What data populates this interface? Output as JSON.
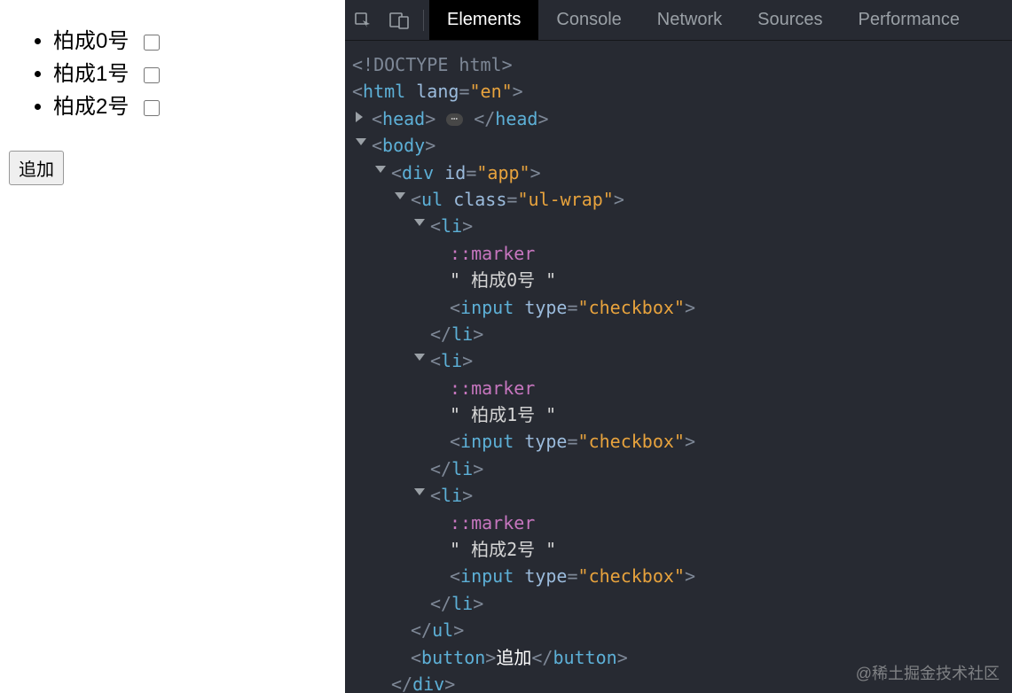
{
  "page": {
    "items": [
      {
        "label": "柏成0号"
      },
      {
        "label": "柏成1号"
      },
      {
        "label": "柏成2号"
      }
    ],
    "button_label": "追加"
  },
  "devtools": {
    "tabs": {
      "elements": "Elements",
      "console": "Console",
      "network": "Network",
      "sources": "Sources",
      "performance": "Performance"
    },
    "dom": {
      "doctype": "<!DOCTYPE html>",
      "html_open_1": "<",
      "html_tag": "html",
      "html_attr_lang": "lang",
      "html_lang_val": "\"en\"",
      "head_tag": "head",
      "body_tag": "body",
      "div_tag": "div",
      "div_attr_id": "id",
      "div_id_val": "\"app\"",
      "ul_tag": "ul",
      "ul_attr_class": "class",
      "ul_class_val": "\"ul-wrap\"",
      "li_tag": "li",
      "marker": "::marker",
      "li_text_0": "\" 柏成0号 \"",
      "li_text_1": "\" 柏成1号 \"",
      "li_text_2": "\" 柏成2号 \"",
      "input_tag": "input",
      "input_attr_type": "type",
      "input_type_val": "\"checkbox\"",
      "button_tag": "button",
      "button_text": "追加",
      "gt": ">",
      "lt": "<",
      "slash": "/",
      "eq": "=",
      "space": " "
    }
  },
  "watermark": "@稀土掘金技术社区"
}
